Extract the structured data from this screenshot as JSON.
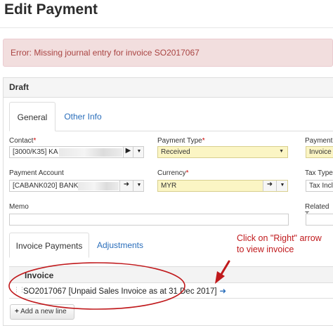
{
  "page": {
    "title": "Edit Payment"
  },
  "alert": {
    "text": "Error: Missing journal entry for invoice SO2017067"
  },
  "panel": {
    "heading": "Draft"
  },
  "tabs": [
    {
      "label": "General",
      "active": true
    },
    {
      "label": "Other Info",
      "active": false
    }
  ],
  "form": {
    "contact": {
      "label": "Contact",
      "required": "*",
      "value": "[3000/K35] KA"
    },
    "payment_type": {
      "label": "Payment Type",
      "required": "*",
      "value": "Received"
    },
    "payment_ref": {
      "label": "Payment",
      "value": "Invoice I"
    },
    "payment_account": {
      "label": "Payment Account",
      "value": "[CABANK020] BANK"
    },
    "currency": {
      "label": "Currency",
      "required": "*",
      "value": "MYR"
    },
    "tax_type": {
      "label": "Tax Type",
      "value": "Tax Incl"
    },
    "memo": {
      "label": "Memo",
      "value": ""
    },
    "related": {
      "label": "Related T"
    }
  },
  "sub_tabs": [
    {
      "label": "Invoice Payments",
      "active": true
    },
    {
      "label": "Adjustments",
      "active": false
    }
  ],
  "grid": {
    "column": "Invoice",
    "rows": [
      {
        "text": "SO2017067 [Unpaid Sales Invoice as at 31 Dec 2017]"
      }
    ],
    "add_label": "Add a new line"
  },
  "annotation": {
    "line1": "Click on \"Right\" arrow",
    "line2": "to view invoice",
    "color": "#c0191c"
  },
  "colors": {
    "alert_bg": "#f2dede",
    "alert_text": "#a94442",
    "link": "#2a6ebb",
    "highlight_field": "#fbf5c4"
  }
}
